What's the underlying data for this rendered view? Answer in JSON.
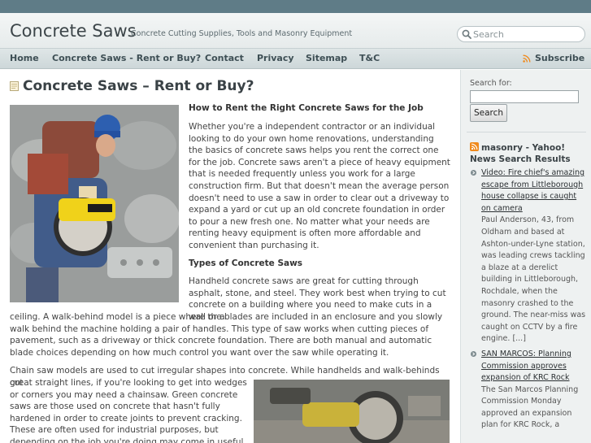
{
  "header": {
    "site_title": "Concrete Saws",
    "site_description": "Concrete Cutting Supplies, Tools and Masonry Equipment",
    "search_placeholder": "Search"
  },
  "nav": {
    "items": [
      "Home",
      "Concrete Saws - Rent or Buy?",
      "Contact",
      "Privacy",
      "Sitemap",
      "T&C"
    ],
    "subscribe": "Subscribe"
  },
  "post": {
    "title": "Concrete Saws – Rent or Buy?",
    "subhead1": "How to Rent the Right Concrete Saws for the Job",
    "para1": "Whether you're a independent contractor or an individual looking to do your own home renovations, understanding the basics of concrete saws helps you rent the correct one for the job. Concrete saws aren't a piece of heavy equipment that is needed frequently unless you work for a large construction firm. But that doesn't mean the average person doesn't need to use a saw in order to clear out a driveway to expand a yard or cut up an old concrete foundation in order to pour a new fresh one. No matter what your needs are renting heavy equipment is often more affordable and convenient than purchasing it.",
    "subhead2": "Types of Concrete Saws",
    "para2a": "Handheld concrete saws are great for cutting through asphalt, stone, and steel. They work best when trying to cut concrete on a building where you need to make cuts in a wall or a",
    "para2b": "ceiling. A walk-behind model is a piece where the blades are included in an enclosure and you slowly walk behind the machine holding a pair of handles. This type of saw works when cutting pieces of pavement, such as a driveway or thick concrete foundation. There are both manual and automatic blade choices depending on how much control you want over the saw while operating it.",
    "para3a": "Chain saw models are used to cut irregular shapes into concrete. While handhelds and walk-behinds cut",
    "para3b": "great straight lines, if you're looking to get into wedges or corners you may need a chainsaw. Green concrete saws are those used on concrete that hasn't fully hardened in order to create joints to prevent cracking. These are often used for industrial purposes, but depending on the job you're doing may come in useful."
  },
  "sidebar": {
    "search_label": "Search for:",
    "search_button": "Search",
    "widget_title": "masonry - Yahoo! News Search Results",
    "news": [
      {
        "headline": "Video: Fire chief's amazing escape from Littleborough house collapse is caught on camera",
        "summary": "Paul Anderson, 43, from Oldham and based at Ashton-under-Lyne station, was leading crews tackling a blaze at a derelict building in Littleborough, Rochdale, when the masonry crashed to the ground. The near-miss was caught on CCTV by a fire engine. [...]"
      },
      {
        "headline": "SAN MARCOS: Planning Commission approves expansion of KRC Rock",
        "summary": "The San Marcos Planning Commission Monday approved an expansion plan for KRC Rock, a"
      }
    ]
  },
  "colors": {
    "topstrip": "#5f7c87",
    "nav_text": "#3e4f55",
    "rss": "#f08a1c"
  }
}
